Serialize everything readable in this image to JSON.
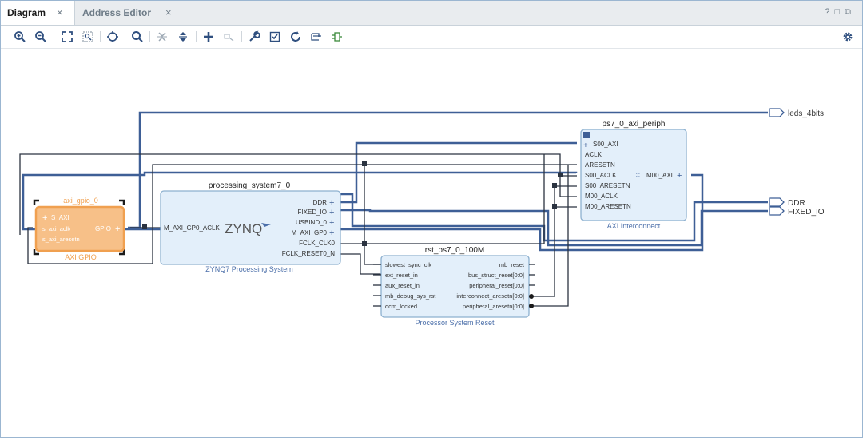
{
  "tabs": [
    {
      "label": "Diagram",
      "close": "×",
      "active": true
    },
    {
      "label": "Address Editor",
      "close": "×",
      "active": false
    }
  ],
  "window_controls": {
    "help": "?",
    "restore": "□",
    "float": "⧉"
  },
  "toolbar": {
    "icons": [
      "zoom-in-icon",
      "zoom-out-icon",
      "fit-view-icon",
      "zoom-area-icon",
      "auto-fit-icon",
      "search-icon",
      "collapse-icon",
      "expand-icon",
      "add-ip-icon",
      "make-external-icon",
      "wrench-icon",
      "validate-icon",
      "refresh-icon",
      "regenerate-layout-icon",
      "optimize-routing-icon"
    ],
    "settings_icon": "gear-icon"
  },
  "diagram": {
    "external_ports": {
      "leds": "leds_4bits",
      "ddr": "DDR",
      "fixed_io": "FIXED_IO"
    },
    "axi_gpio": {
      "instance": "axi_gpio_0",
      "title": "AXI GPIO",
      "ports_left": [
        "S_AXI",
        "s_axi_aclk",
        "s_axi_aresetn"
      ],
      "port_right": "GPIO"
    },
    "ps7": {
      "instance": "processing_system7_0",
      "title": "ZYNQ7 Processing System",
      "logo": "ZYNQ",
      "port_left": "M_AXI_GP0_ACLK",
      "ports_right": [
        "DDR",
        "FIXED_IO",
        "USBIND_0",
        "M_AXI_GP0",
        "FCLK_CLK0",
        "FCLK_RESET0_N"
      ]
    },
    "interconnect": {
      "instance": "ps7_0_axi_periph",
      "title": "AXI Interconnect",
      "ports_left": [
        "S00_AXI",
        "ACLK",
        "ARESETN",
        "S00_ACLK",
        "S00_ARESETN",
        "M00_ACLK",
        "M00_ARESETN"
      ],
      "port_right": "M00_AXI"
    },
    "reset": {
      "instance": "rst_ps7_0_100M",
      "title": "Processor System Reset",
      "ports_left": [
        "slowest_sync_clk",
        "ext_reset_in",
        "aux_reset_in",
        "mb_debug_sys_rst",
        "dcm_locked"
      ],
      "ports_right": [
        "mb_reset",
        "bus_struct_reset[0:0]",
        "peripheral_reset[0:0]",
        "interconnect_aresetn[0:0]",
        "peripheral_aresetn[0:0]"
      ]
    }
  },
  "colors": {
    "wire": "#3e5f96",
    "block_fill": "#e3effa",
    "block_border": "#8db0cf",
    "selected": "#f0a050",
    "label": "#444444",
    "title": "#4a6ea9"
  }
}
